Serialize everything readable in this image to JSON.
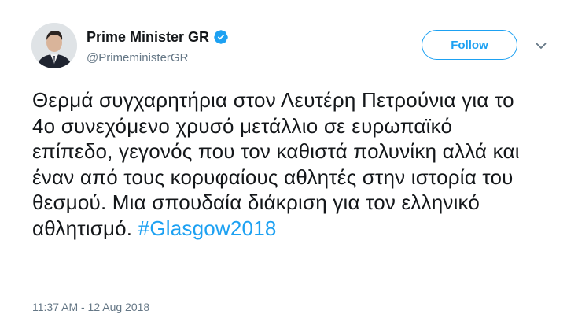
{
  "author": {
    "display_name": "Prime Minister GR",
    "handle": "@PrimeministerGR",
    "verified": true,
    "avatar_icon": "avatar-photo"
  },
  "actions": {
    "follow_label": "Follow",
    "menu_icon": "chevron-down-icon"
  },
  "tweet": {
    "text": "Θερμά συγχαρητήρια στον Λευτέρη Πετρούνια για το 4ο συνεχόμενο χρυσό μετάλλιο σε ευρωπαϊκό επίπεδο, γεγονός που τον καθιστά πολυνίκη αλλά και έναν από τους κορυφαίους αθλητές στην ιστορία του θεσμού. Μια σπουδαία διάκριση για τον ελληνικό αθλητισμό.",
    "hashtag": "#Glasgow2018",
    "timestamp": "11:37 AM - 12 Aug 2018"
  },
  "colors": {
    "accent": "#1da1f2",
    "text_primary": "#14171a",
    "text_secondary": "#657786"
  }
}
